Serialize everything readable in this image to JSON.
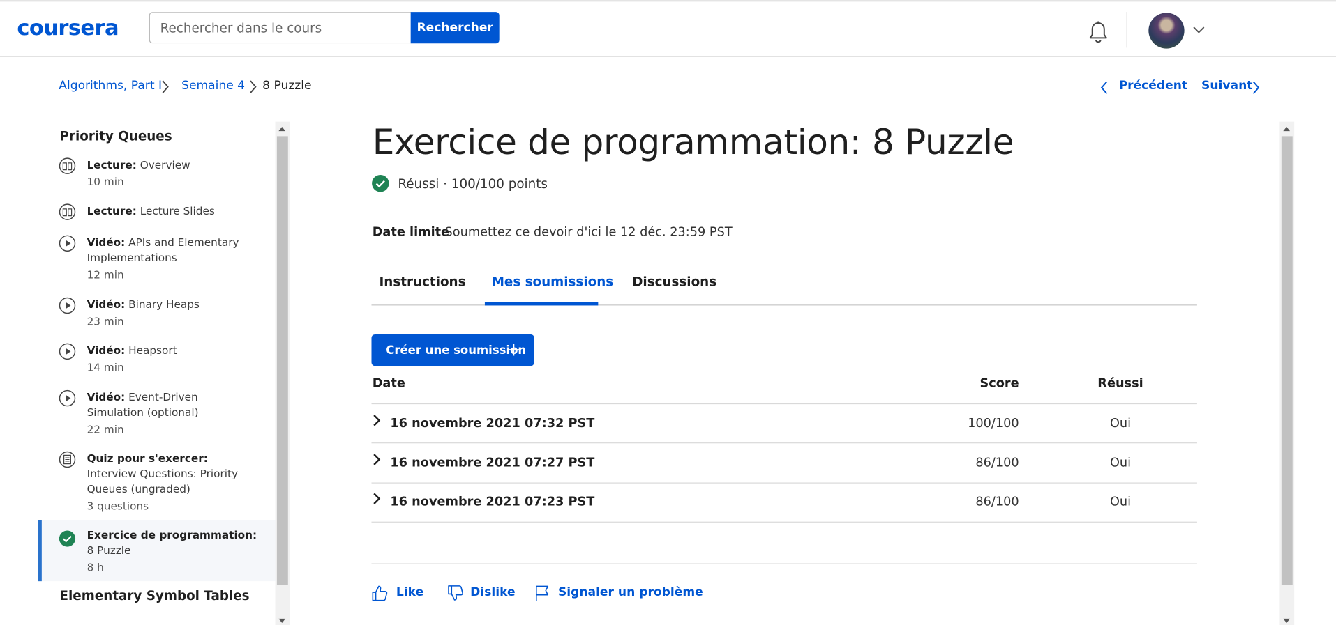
{
  "header": {
    "logo": "coursera",
    "search_placeholder": "Rechercher dans le cours",
    "search_button": "Rechercher"
  },
  "breadcrumb": {
    "items": [
      "Algorithms, Part I",
      "Semaine 4",
      "8 Puzzle"
    ]
  },
  "pager": {
    "previous": "Précédent",
    "next": "Suivant"
  },
  "sidebar": {
    "section_title": "Priority Queues",
    "items": [
      {
        "type": "Lecture:",
        "title": "Overview",
        "duration": "10 min",
        "icon": "book-icon"
      },
      {
        "type": "Lecture:",
        "title": "Lecture Slides",
        "duration": "",
        "icon": "book-icon"
      },
      {
        "type": "Vidéo:",
        "title": "APIs and Elementary Implementations",
        "duration": "12 min",
        "icon": "play-icon"
      },
      {
        "type": "Vidéo:",
        "title": "Binary Heaps",
        "duration": "23 min",
        "icon": "play-icon"
      },
      {
        "type": "Vidéo:",
        "title": "Heapsort",
        "duration": "14 min",
        "icon": "play-icon"
      },
      {
        "type": "Vidéo:",
        "title": "Event-Driven Simulation (optional)",
        "duration": "22 min",
        "icon": "play-icon"
      },
      {
        "type": "Quiz pour s'exercer:",
        "title": "Interview Questions: Priority Queues (ungraded)",
        "duration": "3 questions",
        "icon": "quiz-icon"
      },
      {
        "type": "Exercice de programmation:",
        "title": "8 Puzzle",
        "duration": "8 h",
        "icon": "check-circle-icon"
      }
    ],
    "next_section_title": "Elementary Symbol Tables"
  },
  "main": {
    "title": "Exercice de programmation: 8 Puzzle",
    "status": "Réussi · 100/100 points",
    "deadline_label": "Date limite",
    "deadline_text": "Soumettez ce devoir d'ici le 12 déc. 23:59 PST",
    "tabs": [
      "Instructions",
      "Mes soumissions",
      "Discussions"
    ],
    "active_tab": "Mes soumissions",
    "create_button": "Créer une soumission",
    "table": {
      "headers": [
        "Date",
        "Score",
        "Réussi"
      ],
      "rows": [
        {
          "date": "16 novembre 2021 07:32 PST",
          "score": "100/100",
          "passed": "Oui"
        },
        {
          "date": "16 novembre 2021 07:27 PST",
          "score": "86/100",
          "passed": "Oui"
        },
        {
          "date": "16 novembre 2021 07:23 PST",
          "score": "86/100",
          "passed": "Oui"
        }
      ]
    },
    "feedback": {
      "like": "Like",
      "dislike": "Dislike",
      "report": "Signaler un problème"
    }
  },
  "colors": {
    "brand": "#0056d2",
    "success": "#1f8354",
    "active_sidebar_border": "#2a73cc"
  }
}
